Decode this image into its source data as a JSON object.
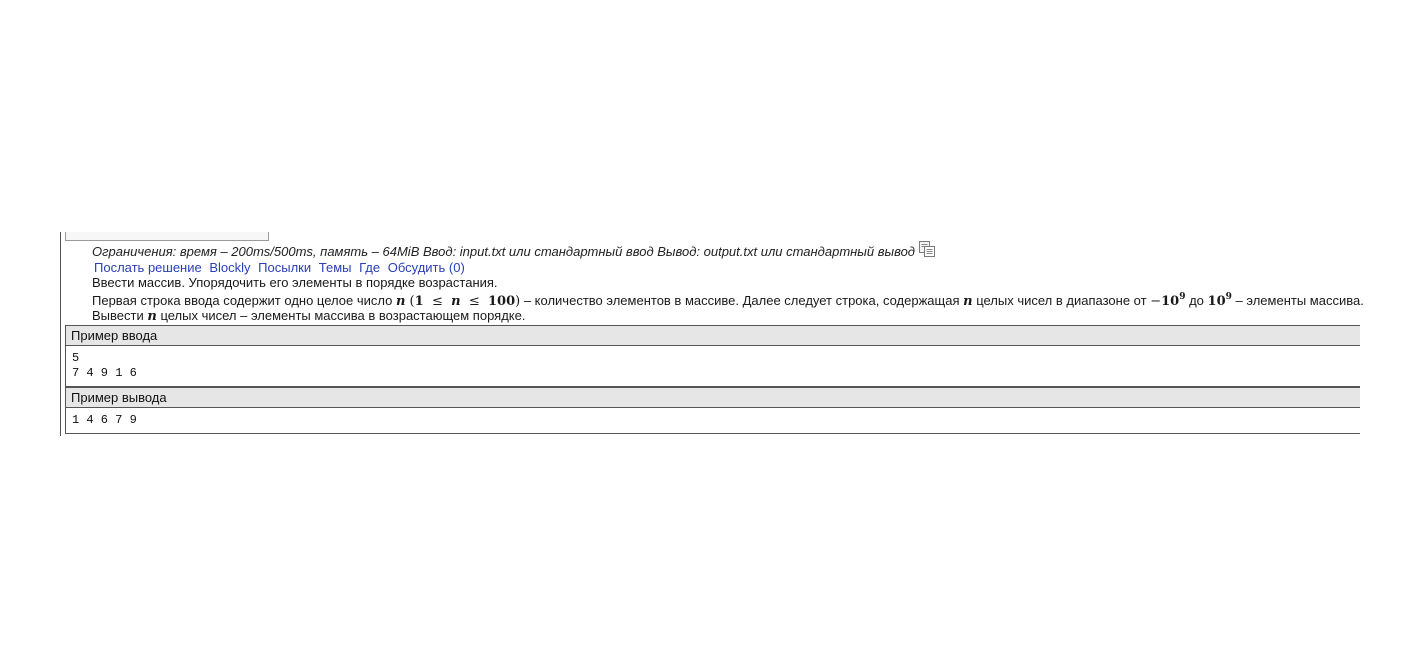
{
  "problem": {
    "limits": "Ограничения: время – 200ms/500ms, память – 64MiB Ввод: input.txt или стандартный ввод Вывод: output.txt или стандартный вывод",
    "copy_icon": "copy-icon",
    "links": [
      "Послать решение",
      "Blockly",
      "Посылки",
      "Темы",
      "Где",
      "Обсудить (0)"
    ],
    "statement": {
      "line1": "Ввести массив. Упорядочить его элементы в порядке возрастания.",
      "line2_part1": "Первая строка ввода содержит одно целое число",
      "n": "n",
      "paren_open": "(",
      "one": "1",
      "le": "≤",
      "hundred": "100",
      "paren_close": ")",
      "line2_part2": "– количество элементов в массиве. Далее следует строка, содержащая",
      "line2_part3": "целых чисел в диапазоне от",
      "minus": "−",
      "ten": "10",
      "nine": "9",
      "do": "до",
      "line2_part4": "– элементы массива.",
      "line3_part1": "Вывести",
      "line3_part2": "целых чисел – элементы массива в возрастающем порядке."
    },
    "example_input": {
      "title": "Пример ввода",
      "text": "5\n7 4 9 1 6"
    },
    "example_output": {
      "title": "Пример вывода",
      "text": "1 4 6 7 9"
    }
  }
}
